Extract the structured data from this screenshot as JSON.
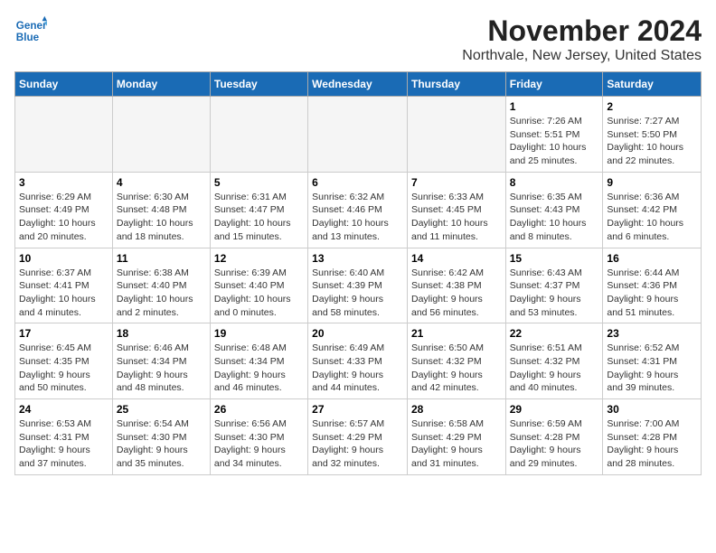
{
  "logo": {
    "line1": "General",
    "line2": "Blue"
  },
  "header": {
    "month": "November 2024",
    "location": "Northvale, New Jersey, United States"
  },
  "weekdays": [
    "Sunday",
    "Monday",
    "Tuesday",
    "Wednesday",
    "Thursday",
    "Friday",
    "Saturday"
  ],
  "weeks": [
    [
      {
        "day": "",
        "info": ""
      },
      {
        "day": "",
        "info": ""
      },
      {
        "day": "",
        "info": ""
      },
      {
        "day": "",
        "info": ""
      },
      {
        "day": "",
        "info": ""
      },
      {
        "day": "1",
        "info": "Sunrise: 7:26 AM\nSunset: 5:51 PM\nDaylight: 10 hours\nand 25 minutes."
      },
      {
        "day": "2",
        "info": "Sunrise: 7:27 AM\nSunset: 5:50 PM\nDaylight: 10 hours\nand 22 minutes."
      }
    ],
    [
      {
        "day": "3",
        "info": "Sunrise: 6:29 AM\nSunset: 4:49 PM\nDaylight: 10 hours\nand 20 minutes."
      },
      {
        "day": "4",
        "info": "Sunrise: 6:30 AM\nSunset: 4:48 PM\nDaylight: 10 hours\nand 18 minutes."
      },
      {
        "day": "5",
        "info": "Sunrise: 6:31 AM\nSunset: 4:47 PM\nDaylight: 10 hours\nand 15 minutes."
      },
      {
        "day": "6",
        "info": "Sunrise: 6:32 AM\nSunset: 4:46 PM\nDaylight: 10 hours\nand 13 minutes."
      },
      {
        "day": "7",
        "info": "Sunrise: 6:33 AM\nSunset: 4:45 PM\nDaylight: 10 hours\nand 11 minutes."
      },
      {
        "day": "8",
        "info": "Sunrise: 6:35 AM\nSunset: 4:43 PM\nDaylight: 10 hours\nand 8 minutes."
      },
      {
        "day": "9",
        "info": "Sunrise: 6:36 AM\nSunset: 4:42 PM\nDaylight: 10 hours\nand 6 minutes."
      }
    ],
    [
      {
        "day": "10",
        "info": "Sunrise: 6:37 AM\nSunset: 4:41 PM\nDaylight: 10 hours\nand 4 minutes."
      },
      {
        "day": "11",
        "info": "Sunrise: 6:38 AM\nSunset: 4:40 PM\nDaylight: 10 hours\nand 2 minutes."
      },
      {
        "day": "12",
        "info": "Sunrise: 6:39 AM\nSunset: 4:40 PM\nDaylight: 10 hours\nand 0 minutes."
      },
      {
        "day": "13",
        "info": "Sunrise: 6:40 AM\nSunset: 4:39 PM\nDaylight: 9 hours\nand 58 minutes."
      },
      {
        "day": "14",
        "info": "Sunrise: 6:42 AM\nSunset: 4:38 PM\nDaylight: 9 hours\nand 56 minutes."
      },
      {
        "day": "15",
        "info": "Sunrise: 6:43 AM\nSunset: 4:37 PM\nDaylight: 9 hours\nand 53 minutes."
      },
      {
        "day": "16",
        "info": "Sunrise: 6:44 AM\nSunset: 4:36 PM\nDaylight: 9 hours\nand 51 minutes."
      }
    ],
    [
      {
        "day": "17",
        "info": "Sunrise: 6:45 AM\nSunset: 4:35 PM\nDaylight: 9 hours\nand 50 minutes."
      },
      {
        "day": "18",
        "info": "Sunrise: 6:46 AM\nSunset: 4:34 PM\nDaylight: 9 hours\nand 48 minutes."
      },
      {
        "day": "19",
        "info": "Sunrise: 6:48 AM\nSunset: 4:34 PM\nDaylight: 9 hours\nand 46 minutes."
      },
      {
        "day": "20",
        "info": "Sunrise: 6:49 AM\nSunset: 4:33 PM\nDaylight: 9 hours\nand 44 minutes."
      },
      {
        "day": "21",
        "info": "Sunrise: 6:50 AM\nSunset: 4:32 PM\nDaylight: 9 hours\nand 42 minutes."
      },
      {
        "day": "22",
        "info": "Sunrise: 6:51 AM\nSunset: 4:32 PM\nDaylight: 9 hours\nand 40 minutes."
      },
      {
        "day": "23",
        "info": "Sunrise: 6:52 AM\nSunset: 4:31 PM\nDaylight: 9 hours\nand 39 minutes."
      }
    ],
    [
      {
        "day": "24",
        "info": "Sunrise: 6:53 AM\nSunset: 4:31 PM\nDaylight: 9 hours\nand 37 minutes."
      },
      {
        "day": "25",
        "info": "Sunrise: 6:54 AM\nSunset: 4:30 PM\nDaylight: 9 hours\nand 35 minutes."
      },
      {
        "day": "26",
        "info": "Sunrise: 6:56 AM\nSunset: 4:30 PM\nDaylight: 9 hours\nand 34 minutes."
      },
      {
        "day": "27",
        "info": "Sunrise: 6:57 AM\nSunset: 4:29 PM\nDaylight: 9 hours\nand 32 minutes."
      },
      {
        "day": "28",
        "info": "Sunrise: 6:58 AM\nSunset: 4:29 PM\nDaylight: 9 hours\nand 31 minutes."
      },
      {
        "day": "29",
        "info": "Sunrise: 6:59 AM\nSunset: 4:28 PM\nDaylight: 9 hours\nand 29 minutes."
      },
      {
        "day": "30",
        "info": "Sunrise: 7:00 AM\nSunset: 4:28 PM\nDaylight: 9 hours\nand 28 minutes."
      }
    ]
  ]
}
